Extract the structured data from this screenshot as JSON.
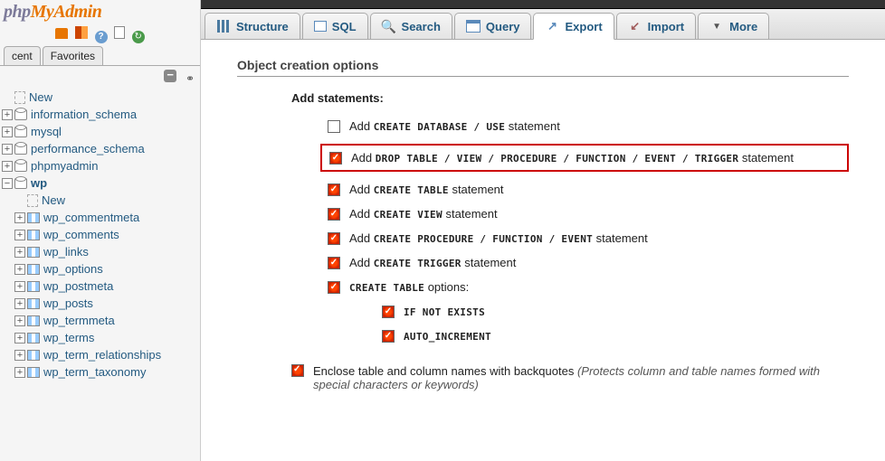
{
  "logo": {
    "part1": "php",
    "part2": "MyAdmin"
  },
  "sidebar_tabs": [
    "cent",
    "Favorites"
  ],
  "tree": {
    "new": "New",
    "dbs": [
      {
        "name": "information_schema"
      },
      {
        "name": "mysql"
      },
      {
        "name": "performance_schema"
      },
      {
        "name": "phpmyadmin"
      }
    ],
    "active_db": "wp",
    "db_new": "New",
    "tables": [
      "wp_commentmeta",
      "wp_comments",
      "wp_links",
      "wp_options",
      "wp_postmeta",
      "wp_posts",
      "wp_termmeta",
      "wp_terms",
      "wp_term_relationships",
      "wp_term_taxonomy"
    ]
  },
  "tabs": [
    {
      "label": "Structure",
      "icon": "struct"
    },
    {
      "label": "SQL",
      "icon": "sql"
    },
    {
      "label": "Search",
      "icon": "search"
    },
    {
      "label": "Query",
      "icon": "query"
    },
    {
      "label": "Export",
      "icon": "export",
      "active": true
    },
    {
      "label": "Import",
      "icon": "import"
    },
    {
      "label": "More",
      "icon": "more"
    }
  ],
  "section": {
    "title": "Object creation options",
    "add_statements": "Add statements:",
    "opts": [
      {
        "pre": "Add ",
        "code": "CREATE DATABASE / USE",
        "post": " statement",
        "checked": false,
        "hl": false
      },
      {
        "pre": "Add ",
        "code": "DROP TABLE / VIEW / PROCEDURE / FUNCTION / EVENT / TRIGGER",
        "post": " statement",
        "checked": true,
        "hl": true
      },
      {
        "pre": "Add ",
        "code": "CREATE TABLE",
        "post": " statement",
        "checked": true,
        "hl": false
      },
      {
        "pre": "Add ",
        "code": "CREATE VIEW",
        "post": " statement",
        "checked": true,
        "hl": false
      },
      {
        "pre": "Add ",
        "code": "CREATE PROCEDURE / FUNCTION / EVENT",
        "post": " statement",
        "checked": true,
        "hl": false
      },
      {
        "pre": "Add ",
        "code": "CREATE TRIGGER",
        "post": " statement",
        "checked": true,
        "hl": false
      },
      {
        "pre": "",
        "code": "CREATE TABLE",
        "post": " options:",
        "checked": true,
        "hl": false
      }
    ],
    "subopts": [
      {
        "code": "IF NOT EXISTS",
        "checked": true
      },
      {
        "code": "AUTO_INCREMENT",
        "checked": true
      }
    ],
    "enclose": {
      "text": "Enclose table and column names with backquotes ",
      "hint": "(Protects column and table names formed with special characters or keywords)"
    }
  }
}
